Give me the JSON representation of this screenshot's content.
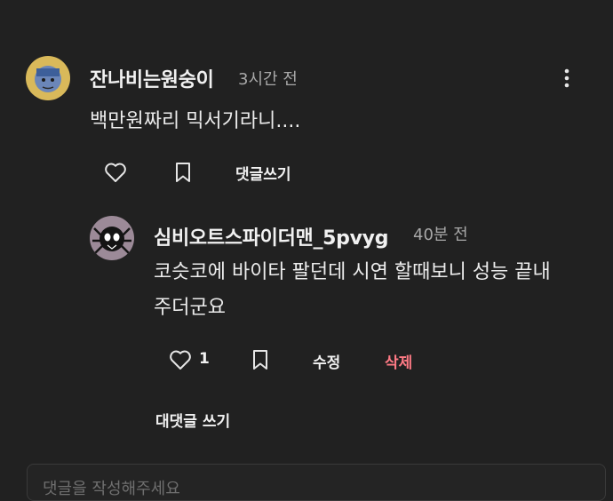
{
  "comment": {
    "author": "잔나비는원숭이",
    "time": "3시간 전",
    "text": "백만원짜리 믹서기라니....",
    "reply_label": "댓글쓰기",
    "more_icon": "more-vertical-icon"
  },
  "reply": {
    "author": "심비오트스파이더맨_5pvyg",
    "time": "40분 전",
    "text_line1": "코슷코에 바이타 팔던데 시연 할때보니 성능 끝내",
    "text_line2": "주더군요",
    "like_count": "1",
    "edit_label": "수정",
    "delete_label": "삭제",
    "reply_label": "대댓글 쓰기"
  },
  "input": {
    "placeholder": "댓글을 작성해주세요"
  },
  "colors": {
    "background": "#212121",
    "delete": "#ff7a85",
    "muted": "#a8a8a8"
  }
}
